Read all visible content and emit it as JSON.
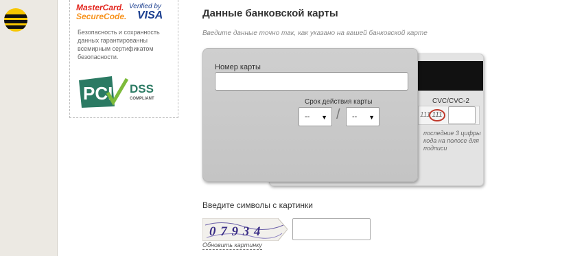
{
  "branding": {
    "logo_icon": "beeline-logo"
  },
  "security": {
    "mastercard_line1": "MasterCard.",
    "mastercard_line2": "SecureCode.",
    "visa_line1": "Verified by",
    "visa_line2": "VISA",
    "text": "Безопасность и сохранность данных гарантированны всемирным сертификатом безопасности.",
    "pci_text": "PCI",
    "pci_dss": "DSS",
    "pci_compliant": "COMPLIANT"
  },
  "form": {
    "title": "Данные банковской карты",
    "note": "Введите данные точно так, как указано на вашей банковской карте",
    "card_number_label": "Номер карты",
    "card_number_value": "",
    "expiry_label": "Срок действия карты",
    "month_value": "--",
    "year_value": "--",
    "slash": "/",
    "cvc_label": "CVC/CVC-2",
    "cvc_sample_1": "111",
    "cvc_sample_2": "111",
    "cvc_value": "",
    "cvc_hint": "последние 3 цифры кода на полосе для подписи"
  },
  "captcha": {
    "title": "Введите символы с картинки",
    "image_text": "0 7 9 3 4",
    "input_value": "",
    "refresh_link": "Обновить картинку"
  },
  "colors": {
    "accent_logo": "#f7c600",
    "cvc_circle": "#c0392b"
  }
}
